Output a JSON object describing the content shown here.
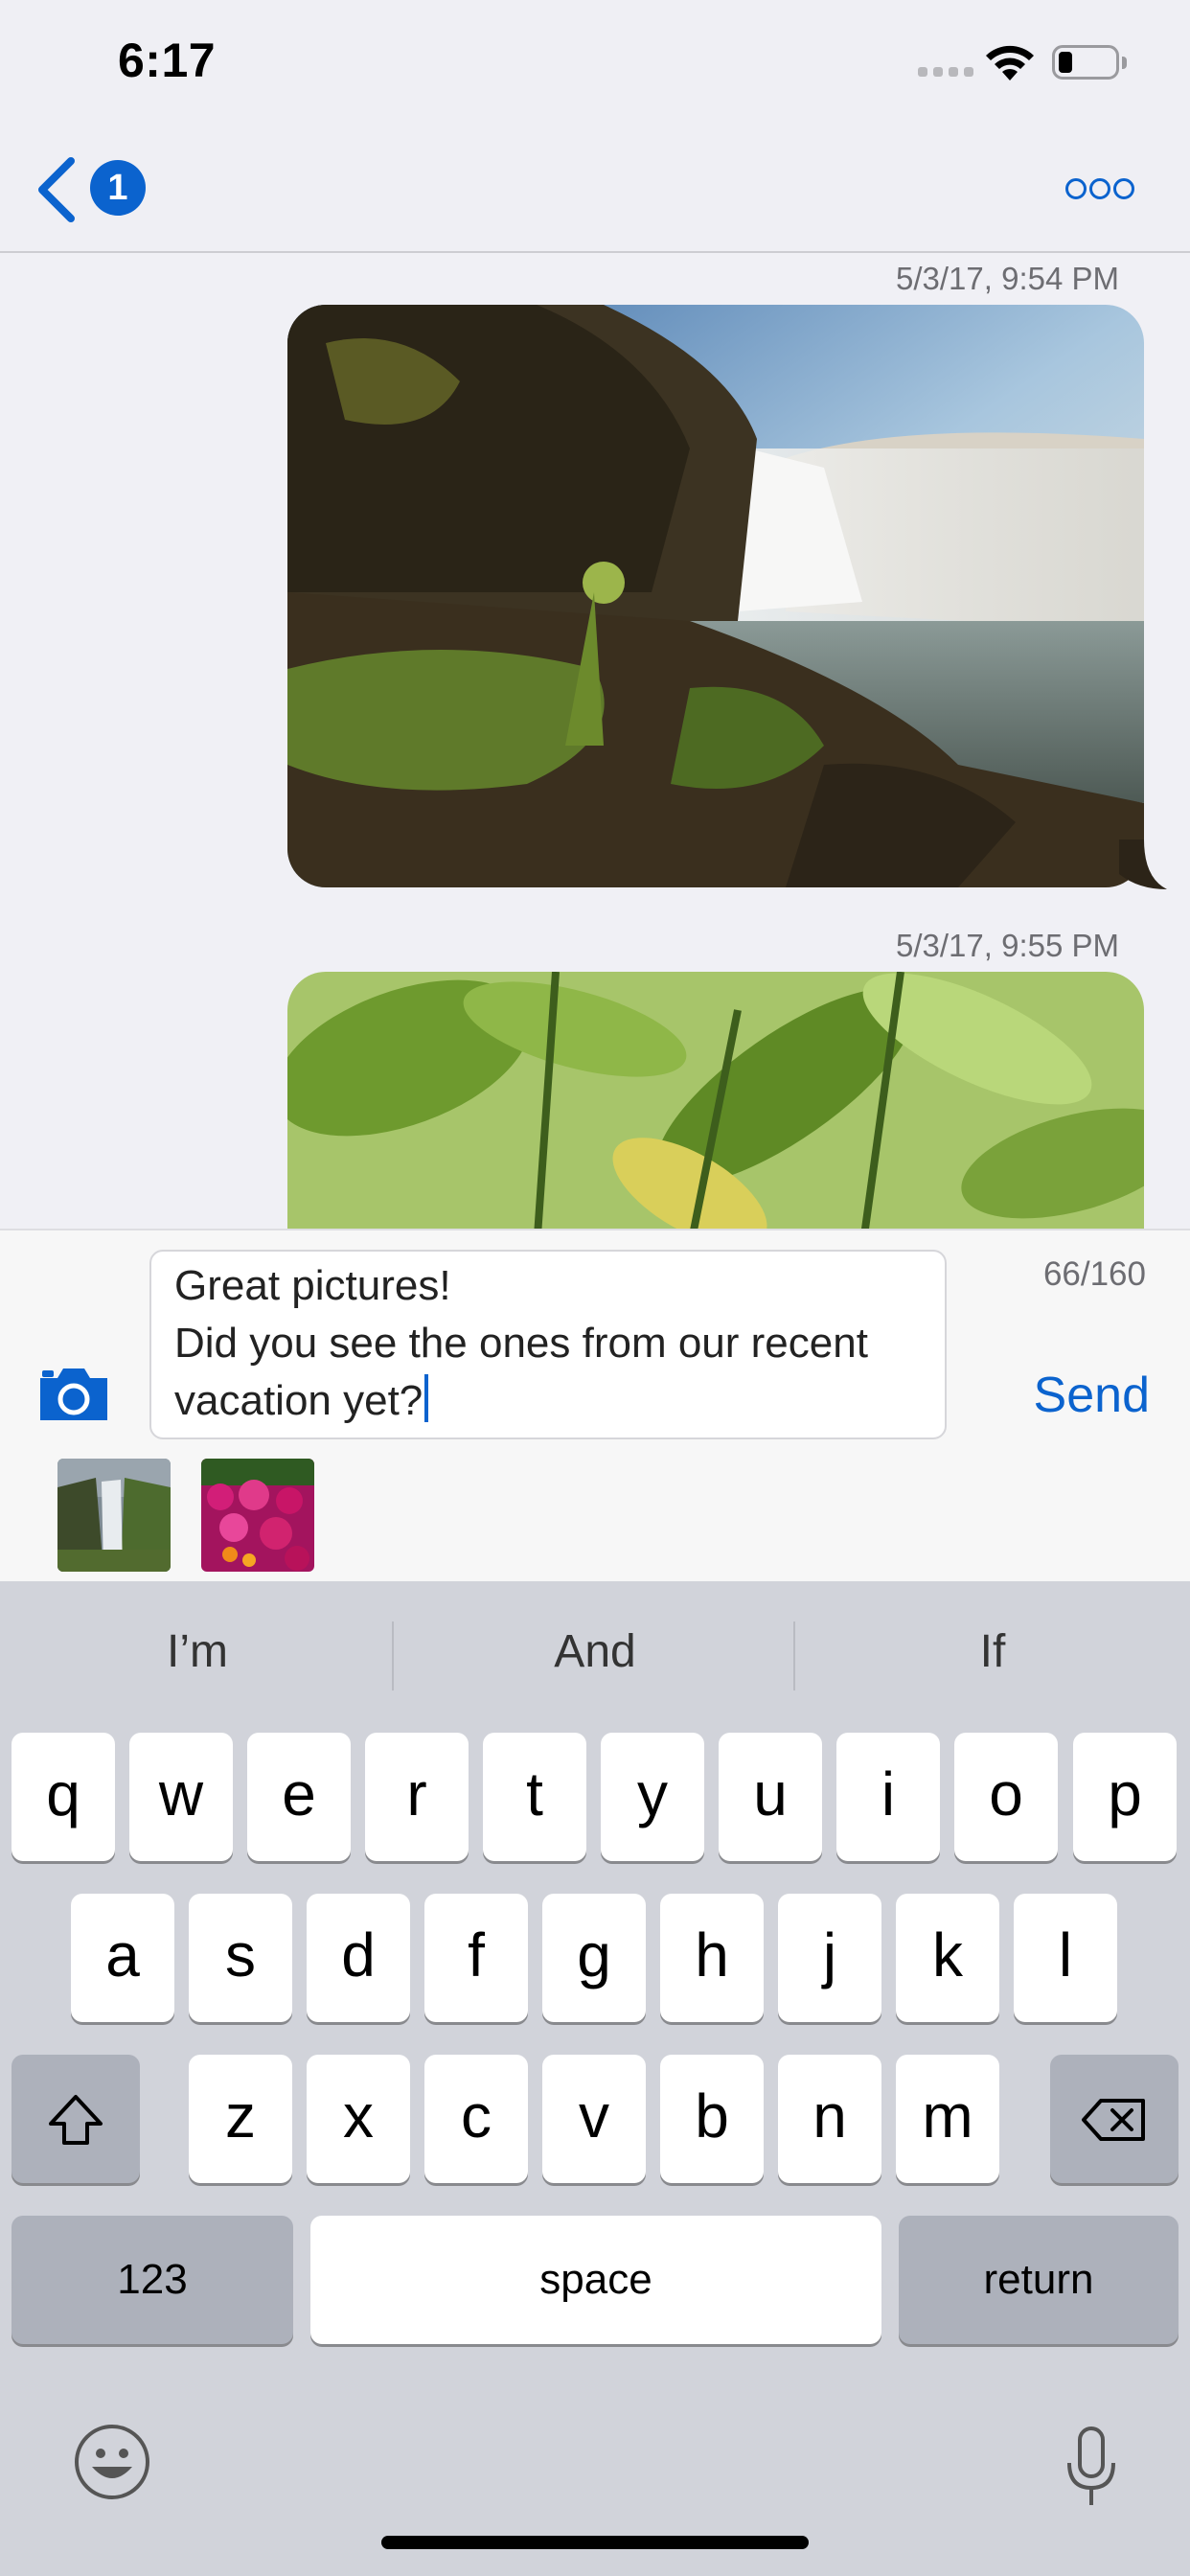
{
  "status_bar": {
    "time": "6:17",
    "icons": [
      "signal-icon",
      "wifi-icon",
      "battery-icon"
    ]
  },
  "nav": {
    "back_badge": "1",
    "icons": [
      "back-chevron-icon",
      "more-icon"
    ]
  },
  "messages": [
    {
      "timestamp": "5/3/17, 9:54 PM",
      "type": "photo",
      "subject": "waterfall"
    },
    {
      "timestamp": "5/3/17, 9:55 PM",
      "type": "photo",
      "subject": "green leaves"
    }
  ],
  "compose": {
    "text": "Great pictures!\nDid you see the ones from our recent vacation yet?",
    "counter": "66/160",
    "send_label": "Send",
    "attachments": [
      "waterfall thumbnail",
      "flowers thumbnail"
    ]
  },
  "keyboard": {
    "suggestions": [
      "I’m",
      "And",
      "If"
    ],
    "rows": [
      [
        "q",
        "w",
        "e",
        "r",
        "t",
        "y",
        "u",
        "i",
        "o",
        "p"
      ],
      [
        "a",
        "s",
        "d",
        "f",
        "g",
        "h",
        "j",
        "k",
        "l"
      ],
      [
        "z",
        "x",
        "c",
        "v",
        "b",
        "n",
        "m"
      ]
    ],
    "numbers_key": "123",
    "space_key": "space",
    "return_key": "return"
  },
  "colors": {
    "accent": "#0b63ce",
    "background": "#f0f0f5",
    "keyboard": "#d1d3da"
  }
}
